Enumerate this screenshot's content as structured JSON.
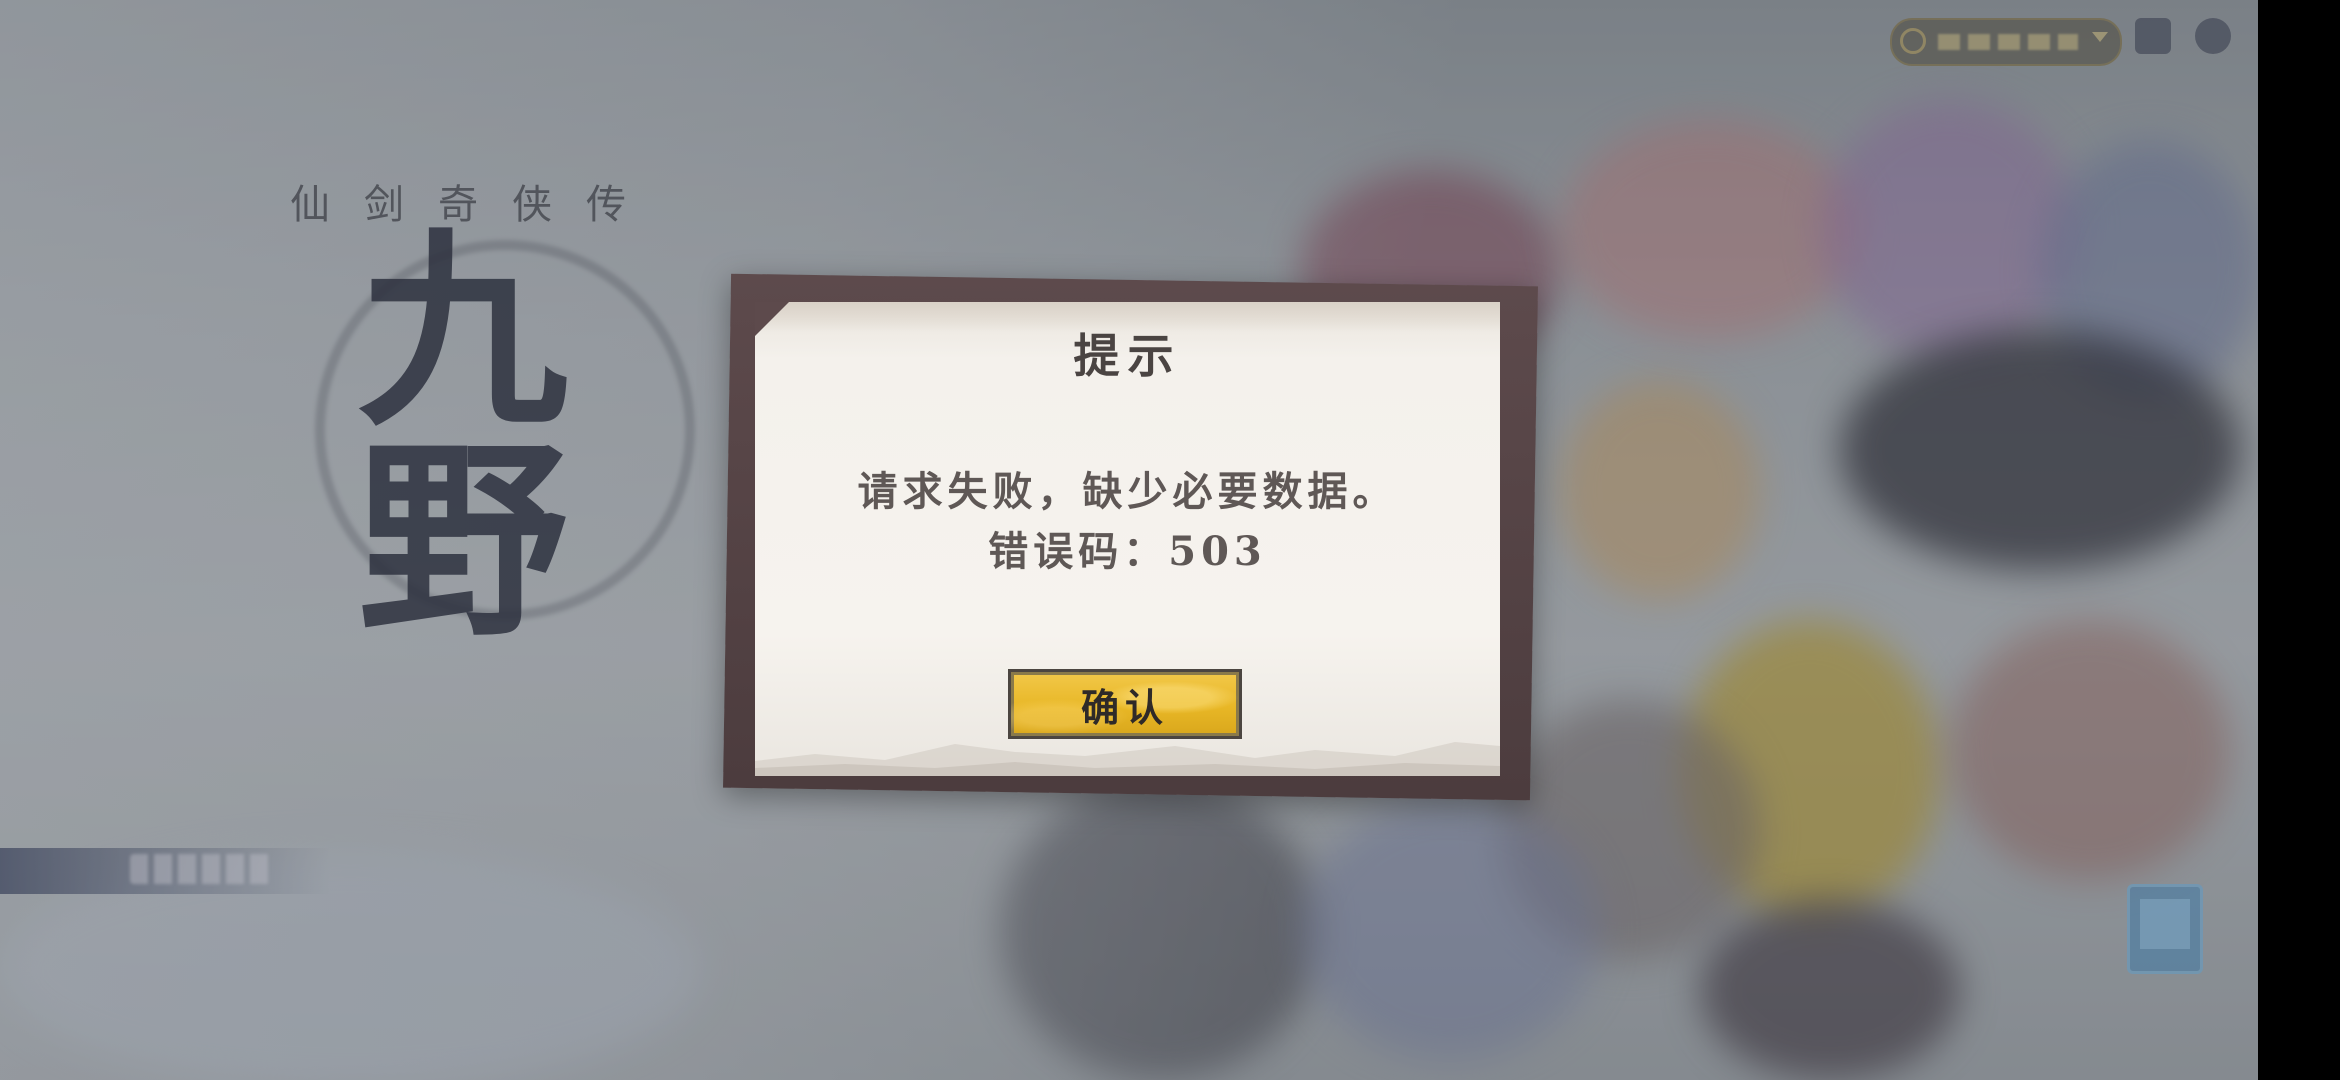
{
  "background": {
    "logo_subtitle": "仙剑奇侠传",
    "logo_title": "九野"
  },
  "dialog": {
    "title": "提示",
    "message": "请求失败，缺少必要数据。",
    "error_code": "错误码：503",
    "confirm_label": "确认"
  },
  "colors": {
    "dialog_bg": "#f6f3ee",
    "dialog_frame": "#5d4a4c",
    "button_gold": "#e8b726",
    "text": "#5f5856"
  },
  "icons": [
    "globe-icon",
    "chevron-down-icon",
    "menu-icon",
    "settings-icon",
    "qr-code-icon"
  ]
}
